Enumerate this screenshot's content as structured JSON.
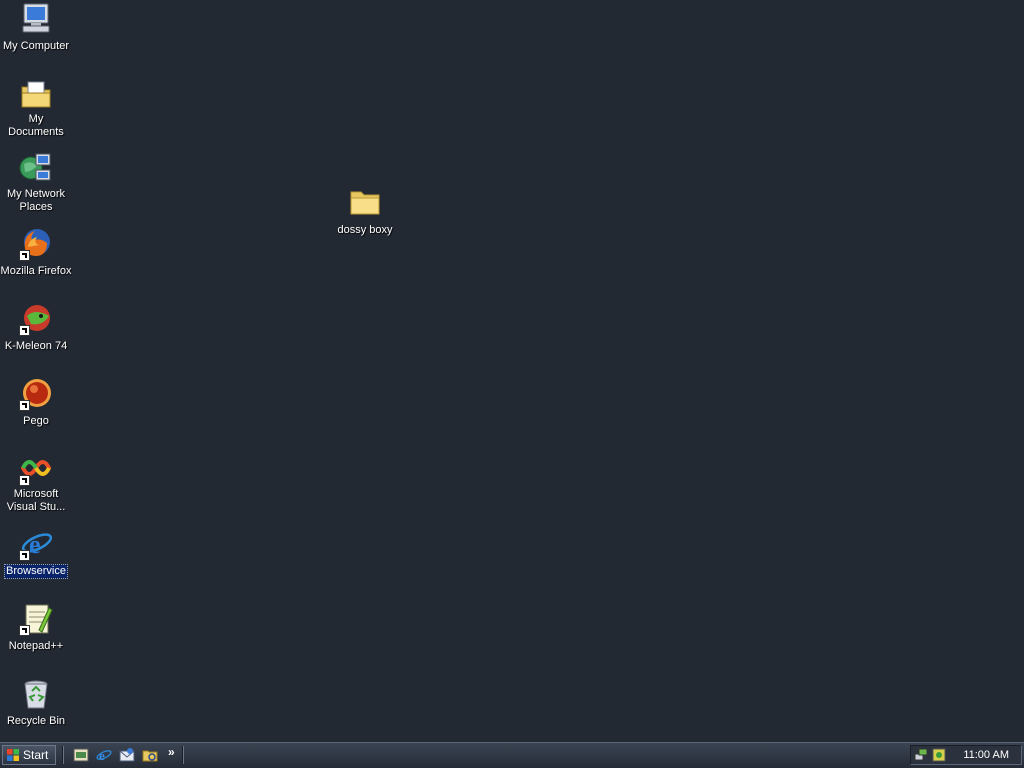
{
  "desktop": {
    "icons": [
      {
        "label": "My Computer",
        "icon": "my-computer-icon"
      },
      {
        "label": "My Documents",
        "icon": "my-documents-icon"
      },
      {
        "label": "My Network Places",
        "icon": "network-places-icon"
      },
      {
        "label": "Mozilla Firefox",
        "icon": "firefox-icon"
      },
      {
        "label": "K-Meleon 74",
        "icon": "k-meleon-icon"
      },
      {
        "label": "Pego",
        "icon": "pego-icon"
      },
      {
        "label": "Microsoft Visual Stu...",
        "icon": "visual-studio-icon"
      },
      {
        "label": "Browservice",
        "icon": "internet-explorer-icon",
        "selected": true
      },
      {
        "label": "Notepad++",
        "icon": "notepad-plus-plus-icon"
      },
      {
        "label": "Recycle Bin",
        "icon": "recycle-bin-icon"
      }
    ],
    "folder": {
      "label": "dossy boxy",
      "icon": "folder-icon"
    }
  },
  "taskbar": {
    "start_label": "Start",
    "quick_launch": [
      "show-desktop-icon",
      "internet-explorer-icon",
      "outlook-express-icon",
      "windows-explorer-icon"
    ],
    "chevron": "»",
    "tray_icons": [
      "network-icon",
      "tray-app-icon"
    ],
    "clock": "11:00 AM"
  },
  "colors": {
    "desktop_bg": "#232933",
    "selection": "#0a246a"
  }
}
